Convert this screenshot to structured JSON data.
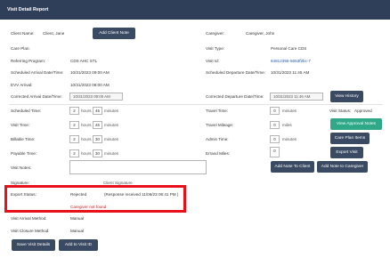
{
  "title": "Visit Detail Report",
  "client": {
    "label": "Client Name:",
    "value": "Client, Jane",
    "button": "Add Client Note"
  },
  "caregiver": {
    "label": "Caregiver:",
    "value": "Caregiver, John"
  },
  "care_plan": {
    "label": "Care Plan:",
    "value": ""
  },
  "visit_type": {
    "label": "Visit Type:",
    "value": "Personal Care CDS"
  },
  "referring_program": {
    "label": "Referring Program:",
    "value": "CDS AHC STL"
  },
  "visit_id": {
    "label": "Visit Id:",
    "value": "64812355-5653f2bc-7"
  },
  "sched_arrival": {
    "label": "Scheduled Arrival Date/Time:",
    "value": "10/31/2023 09:00 AM"
  },
  "sched_departure": {
    "label": "Scheduled Departure Date/Time:",
    "value": "10/31/2023 11:45 AM"
  },
  "evv_arrival": {
    "label": "EVV Arrival:",
    "value": "10/31/2023 08:00 AM"
  },
  "corrected_arrival": {
    "label": "Corrected Arrival Date/Time:",
    "value": "10/31/2023 09:00 AM"
  },
  "corrected_departure": {
    "label": "Corrected Departure Date/Time:",
    "value": "10/31/2023 11:46 AM"
  },
  "view_history": "View History",
  "scheduled_time": {
    "label": "Scheduled Time:",
    "hours": "2",
    "minutes": "45"
  },
  "travel_time": {
    "label": "Travel Time:",
    "minutes": "0"
  },
  "visit_status": {
    "label": "Visit Status:",
    "value": "Approved"
  },
  "visit_time": {
    "label": "Visit Time:",
    "hours": "2",
    "minutes": "46"
  },
  "travel_mileage": {
    "label": "Travel Mileage:",
    "miles": "0"
  },
  "view_approval_notes": "View Approval Notes",
  "billable_time": {
    "label": "Billable Time:",
    "hours": "2",
    "minutes": "30"
  },
  "admin_time": {
    "label": "Admin Time:",
    "minutes": "0"
  },
  "care_plan_items": "Care Plan Items",
  "payable_time": {
    "label": "Payable Time:",
    "hours": "2",
    "minutes": "30"
  },
  "errand_miles": {
    "label": "Errand Miles:",
    "miles": "0"
  },
  "export_visit": "Export Visit",
  "visit_notes": {
    "label": "Visit Notes:",
    "value": ""
  },
  "add_note_client": "Add Note To Client",
  "add_note_caregiver": "Add Note to Caregiver",
  "signature": {
    "label": "Signature:",
    "value": "Client Signature"
  },
  "export_status": {
    "label": "Export Status:",
    "value": "Rejected",
    "detail": "(Response received 11/06/23 06:41 PM )",
    "error": "Caregiver not found"
  },
  "arrival_method": {
    "label": "Visit Arrival Method:",
    "value": "Manual"
  },
  "closure_method": {
    "label": "Visit Closure Method:",
    "value": "Manual"
  },
  "units": {
    "hours": "hours",
    "minutes": "minutes",
    "miles": "miles"
  },
  "buttons": {
    "save": "Save Visit Details",
    "add_visit_id": "Add to Visit ID"
  }
}
